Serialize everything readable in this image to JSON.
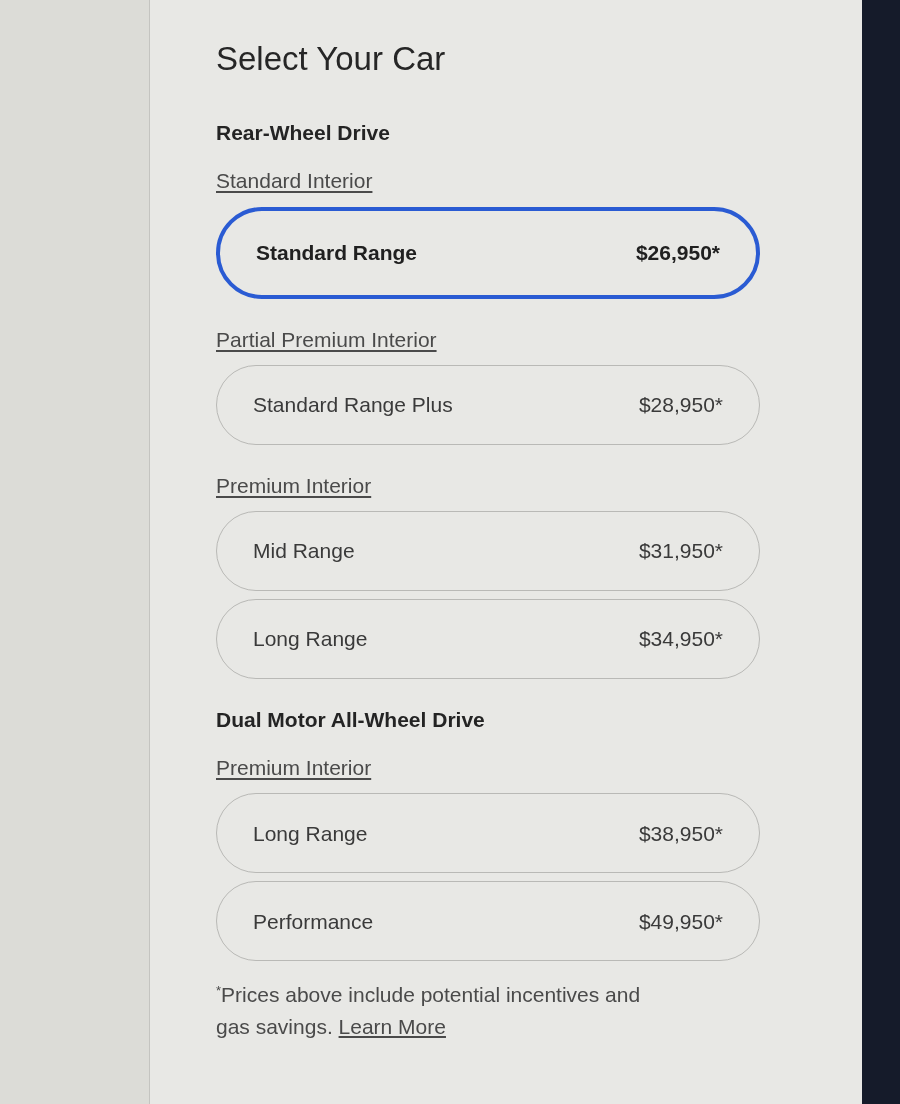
{
  "page": {
    "title": "Select Your Car"
  },
  "drivetrains": [
    {
      "heading": "Rear-Wheel Drive",
      "sections": [
        {
          "interior": "Standard Interior",
          "options": [
            {
              "name": "Standard Range",
              "price": "$26,950*",
              "selected": true
            }
          ]
        },
        {
          "interior": "Partial Premium Interior",
          "options": [
            {
              "name": "Standard Range Plus",
              "price": "$28,950*",
              "selected": false
            }
          ]
        },
        {
          "interior": "Premium Interior",
          "options": [
            {
              "name": "Mid Range",
              "price": "$31,950*",
              "selected": false
            },
            {
              "name": "Long Range",
              "price": "$34,950*",
              "selected": false
            }
          ]
        }
      ]
    },
    {
      "heading": "Dual Motor All-Wheel Drive",
      "sections": [
        {
          "interior": "Premium Interior",
          "options": [
            {
              "name": "Long Range",
              "price": "$38,950*",
              "selected": false
            },
            {
              "name": "Performance",
              "price": "$49,950*",
              "selected": false
            }
          ]
        }
      ]
    }
  ],
  "footnote": {
    "text": "$^{*}$Prices above include potential incentives and gas savings.",
    "link": "Learn More"
  }
}
